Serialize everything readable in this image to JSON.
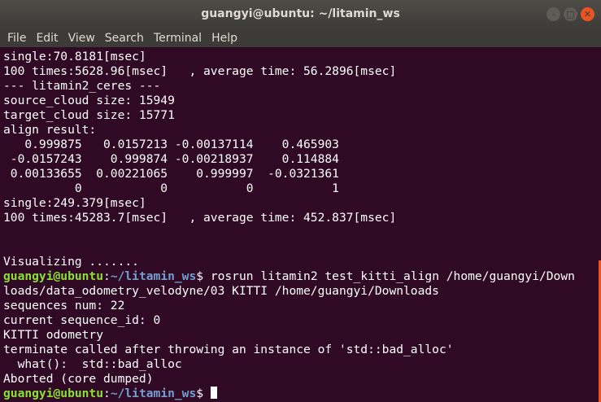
{
  "window": {
    "title": "guangyi@ubuntu: ~/litamin_ws"
  },
  "menu": [
    "File",
    "Edit",
    "View",
    "Search",
    "Terminal",
    "Help"
  ],
  "terminal": {
    "lines": [
      {
        "text": "single:70.8181[msec]"
      },
      {
        "text": "100 times:5628.96[msec]   , average time: 56.2896[msec]"
      },
      {
        "text": "--- litamin2_ceres ---"
      },
      {
        "text": "source_cloud size: 15949"
      },
      {
        "text": "target_cloud size: 15771"
      },
      {
        "text": "align result:"
      },
      {
        "text": "   0.999875   0.0157213 -0.00137114    0.465903"
      },
      {
        "text": " -0.0157243    0.999874 -0.00218937    0.114884"
      },
      {
        "text": " 0.00133655  0.00221065    0.999997  -0.0321361"
      },
      {
        "text": "          0           0           0           1"
      },
      {
        "text": "single:249.379[msec]"
      },
      {
        "text": "100 times:45283.7[msec]   , average time: 452.837[msec]"
      },
      {
        "text": ""
      },
      {
        "text": ""
      },
      {
        "text": "Visualizing ......."
      },
      {
        "user": "guangyi@ubuntu",
        "path": "~/litamin_ws",
        "cmd": "$ rosrun litamin2 test_kitti_align /home/guangyi/Down"
      },
      {
        "text": "loads/data_odometry_velodyne/03 KITTI /home/guangyi/Downloads"
      },
      {
        "text": "sequences num: 22"
      },
      {
        "text": "current sequence_id: 0"
      },
      {
        "text": "KITTI odometry"
      },
      {
        "text": "terminate called after throwing an instance of 'std::bad_alloc'"
      },
      {
        "text": "  what():  std::bad_alloc"
      },
      {
        "text": "Aborted (core dumped)"
      },
      {
        "user": "guangyi@ubuntu",
        "path": "~/litamin_ws",
        "cmd": "$ ",
        "cursor": true
      }
    ]
  }
}
